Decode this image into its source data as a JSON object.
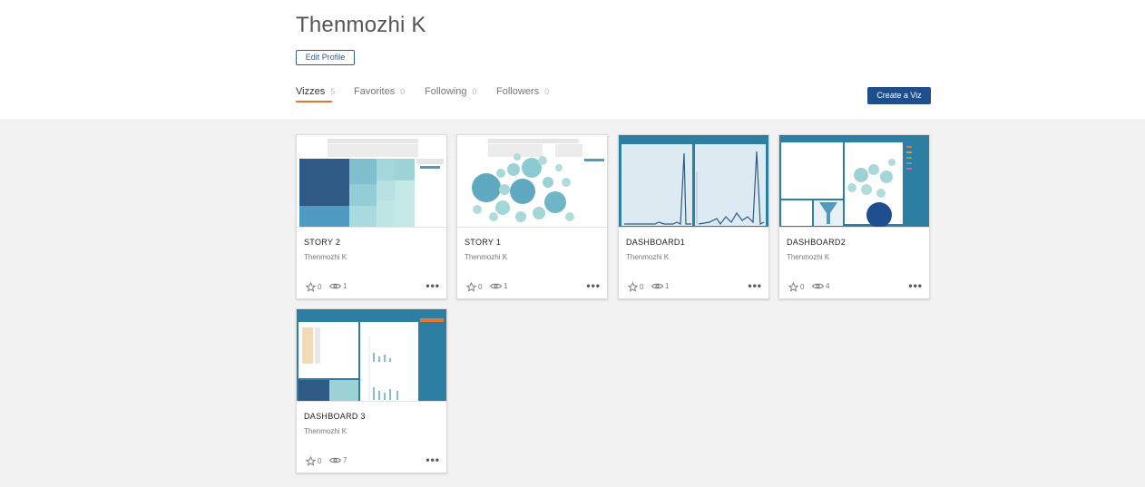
{
  "profile": {
    "name": "Thenmozhi K",
    "edit_label": "Edit Profile"
  },
  "tabs": [
    {
      "label": "Vizzes",
      "count": "5"
    },
    {
      "label": "Favorites",
      "count": "0"
    },
    {
      "label": "Following",
      "count": "0"
    },
    {
      "label": "Followers",
      "count": "0"
    }
  ],
  "create_label": "Create a Viz",
  "colors": {
    "accent": "#e8762b",
    "primary": "#1f4e8c",
    "teal": "#2c7fa3"
  },
  "cards": [
    {
      "title": "STORY 2",
      "author": "Thenmozhi K",
      "favorites": "0",
      "views": "1",
      "more": "•••"
    },
    {
      "title": "STORY 1",
      "author": "Thenmozhi K",
      "favorites": "0",
      "views": "1",
      "more": "•••"
    },
    {
      "title": "DASHBOARD1",
      "author": "Thenmozhi K",
      "favorites": "0",
      "views": "1",
      "more": "•••"
    },
    {
      "title": "DASHBOARD2",
      "author": "Thenmozhi K",
      "favorites": "0",
      "views": "4",
      "more": "•••"
    },
    {
      "title": "DASHBOARD 3",
      "author": "Thenmozhi K",
      "favorites": "0",
      "views": "7",
      "more": "•••"
    }
  ]
}
